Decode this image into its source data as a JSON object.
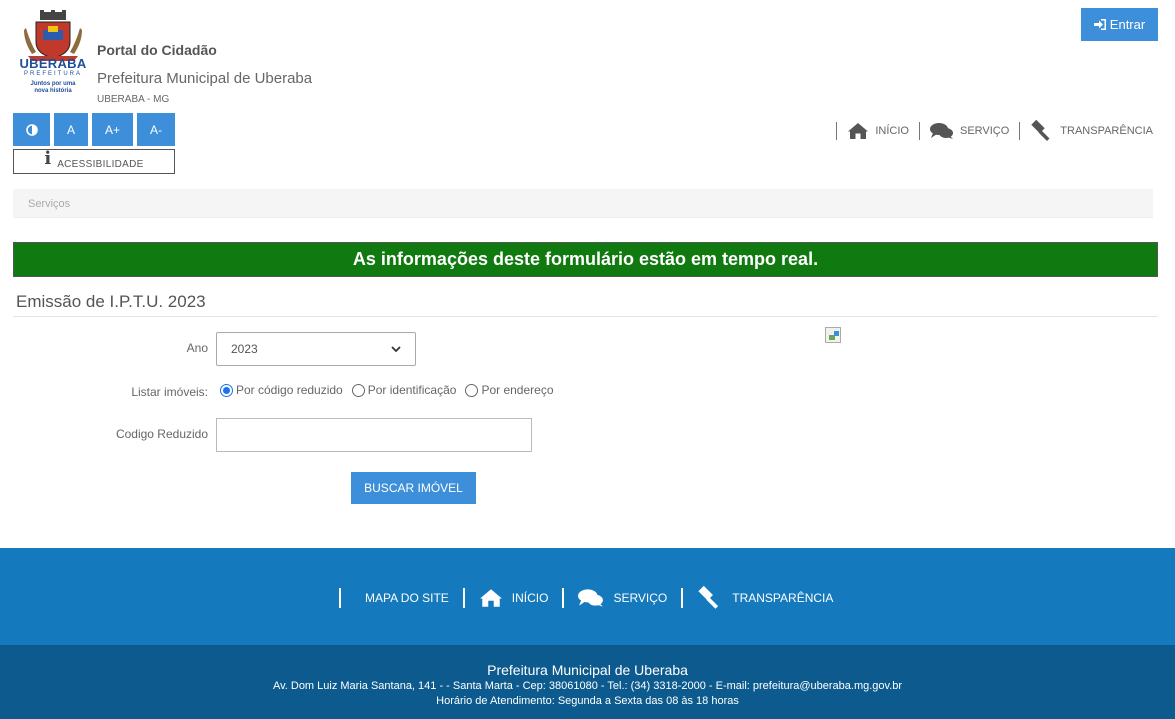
{
  "header": {
    "logo_text": "UBERABA",
    "logo_subtext": "PREFEITURA",
    "logo_tagline": "Juntos por uma nova história",
    "portal_title": "Portal do Cidadão",
    "municipality": "Prefeitura Municipal de Uberaba",
    "city_state": "UBERABA - MG",
    "login_label": "Entrar"
  },
  "accessibility": {
    "contrast_icon": "contrast-icon",
    "normal_label": "A",
    "increase_label": "A+",
    "decrease_label": "A-",
    "label": "ACESSIBILIDADE"
  },
  "nav": {
    "items": [
      {
        "label": "INÍCIO",
        "icon": "home-icon"
      },
      {
        "label": "SERVIÇO",
        "icon": "comments-icon"
      },
      {
        "label": "TRANSPARÊNCIA",
        "icon": "gavel-icon"
      }
    ]
  },
  "breadcrumb": "Serviços",
  "banner": "As informações deste formulário estão em tempo real.",
  "form": {
    "title": "Emissão de I.P.T.U. 2023",
    "year_label": "Ano",
    "year_value": "2023",
    "list_label": "Listar imóveis:",
    "radio_options": [
      {
        "label": "Por código reduzido",
        "checked": true
      },
      {
        "label": "Por identificação",
        "checked": false
      },
      {
        "label": "Por endereço",
        "checked": false
      }
    ],
    "code_label": "Codigo Reduzido",
    "code_value": "",
    "submit_label": "BUSCAR IMÓVEL"
  },
  "footer": {
    "nav": [
      {
        "label": "MAPA DO SITE"
      },
      {
        "label": "INÍCIO",
        "icon": "home-icon"
      },
      {
        "label": "SERVIÇO",
        "icon": "comments-icon"
      },
      {
        "label": "TRANSPARÊNCIA",
        "icon": "gavel-icon"
      }
    ],
    "org": "Prefeitura Municipal de Uberaba",
    "address": "Av. Dom Luiz Maria Santana, 141 - - Santa Marta - Cep: 38061080 - Tel.: (34) 3318-2000 - E-mail: prefeitura@uberaba.mg.gov.br",
    "hours": "Horário de Atendimento: Segunda a Sexta das 08 às 18 horas"
  },
  "colors": {
    "primary_blue": "#3d8fd9",
    "banner_green": "#107a10",
    "footer_blue": "#1579bd",
    "footer_dark": "#0d5b8e"
  }
}
